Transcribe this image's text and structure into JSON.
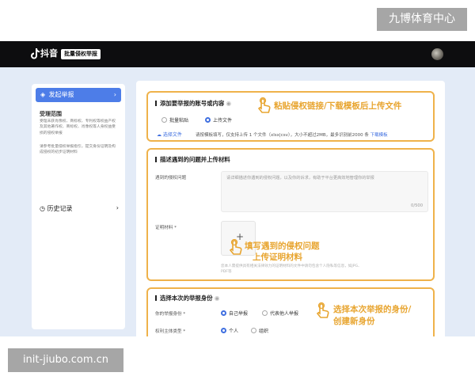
{
  "watermark": {
    "top": "九博体育中心",
    "bottom": "init-jiubo.com.cn"
  },
  "topbar": {
    "app_name": "抖音",
    "tag": "批量侵权举报"
  },
  "sidebar": {
    "active_item": "发起举报",
    "scope_title": "受理范围",
    "scope_text": "受理未获肖像权、商标权、专利权等权益产权及其他著作权、商标权、肖像权等人身权益受损的侵权举报",
    "scope_tip": "请参考批量侵权举报指引，提交身份证明及构成侵权的初步证明材料",
    "history": "历史记录"
  },
  "section1": {
    "title": "添加要举报的账号或内容",
    "callout": "粘贴侵权链接/下载模板后上传文件",
    "option_paste": "批量粘贴",
    "option_upload": "上传文件",
    "select_file": "选择文件",
    "hint": "请按模板填写，仅支持上传 1 个文件（xlsx|csv），大小不超过2MB，最多识别前2000 条",
    "template_link": "下载模板"
  },
  "section2": {
    "title": "描述遇到的问题并上传材料",
    "problem_label": "遇到的侵权问题",
    "problem_placeholder": "请详细描述你遇到的侵权问题，以及你的诉求，有助于平台更高效地管理你的举报",
    "counter": "0/500",
    "evidence_label": "证明材料 *",
    "upload_plus": "+",
    "callout_line1": "填写遇到的侵权问题",
    "callout_line2": "上传证明材料",
    "evidence_hint": "您本人需提供具有相关法律效力的证明材料的文件中请勿包含个人隐私等信息，如JPG、PDF等"
  },
  "section3": {
    "title": "选择本次的举报身份",
    "identity_label": "你的举报身份 *",
    "option_self": "自己举报",
    "option_agent": "代表他人举报",
    "subject_label": "权利主体类型 *",
    "option_person": "个人",
    "option_org": "组织",
    "callout_line1": "选择本次举报的身份/",
    "callout_line2": "创建新身份"
  },
  "colors": {
    "accent": "#4d7de8",
    "highlight": "#efb24a",
    "callout": "#e8a530",
    "topbar": "#0d0d0f"
  },
  "icons": [
    "tiktok-logo-icon",
    "tag-icon",
    "chevron-right-icon",
    "clock-icon",
    "cloud-upload-icon",
    "hand-pointer-icon",
    "plus-icon"
  ]
}
